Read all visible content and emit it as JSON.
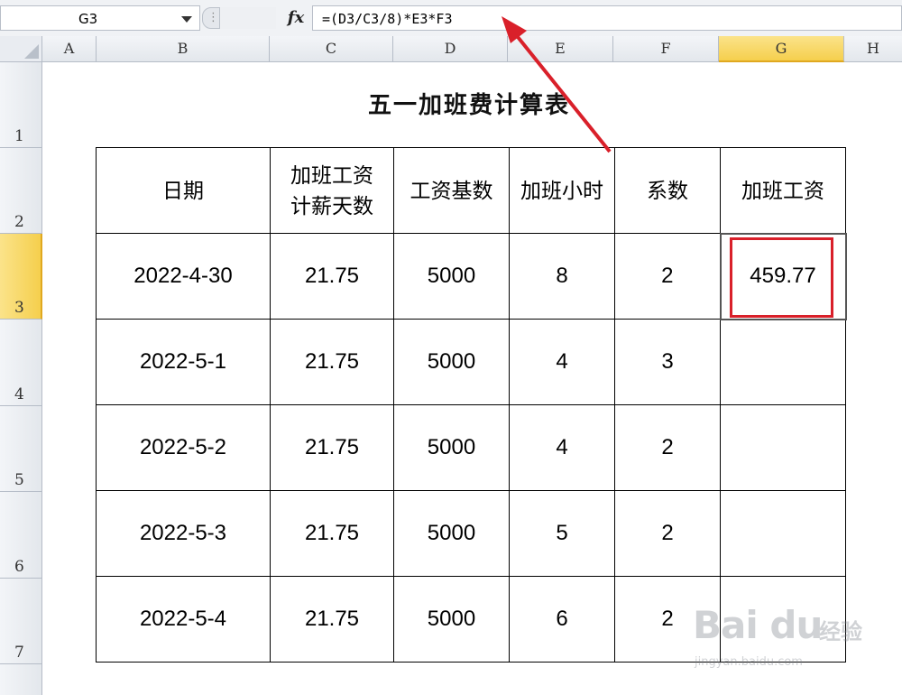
{
  "formula_bar": {
    "cell_ref": "G3",
    "fx_label": "fx",
    "formula": "=(D3/C3/8)*E3*F3"
  },
  "columns": [
    "A",
    "B",
    "C",
    "D",
    "E",
    "F",
    "G",
    "H"
  ],
  "selected_column": "G",
  "rows": [
    "1",
    "2",
    "3",
    "4",
    "5",
    "6",
    "7"
  ],
  "selected_row": "3",
  "sheet": {
    "title": "五一加班费计算表",
    "headers": [
      "日期",
      "加班工资计薪天数",
      "工资基数",
      "加班小时",
      "系数",
      "加班工资"
    ],
    "header_lines": {
      "col_c": [
        "加班工资",
        "计薪天数"
      ]
    },
    "data_rows": [
      {
        "date": "2022-4-30",
        "days": "21.75",
        "base": "5000",
        "hours": "8",
        "coef": "2",
        "pay": "459.77"
      },
      {
        "date": "2022-5-1",
        "days": "21.75",
        "base": "5000",
        "hours": "4",
        "coef": "3",
        "pay": ""
      },
      {
        "date": "2022-5-2",
        "days": "21.75",
        "base": "5000",
        "hours": "4",
        "coef": "2",
        "pay": ""
      },
      {
        "date": "2022-5-3",
        "days": "21.75",
        "base": "5000",
        "hours": "5",
        "coef": "2",
        "pay": ""
      },
      {
        "date": "2022-5-4",
        "days": "21.75",
        "base": "5000",
        "hours": "6",
        "coef": "2",
        "pay": ""
      }
    ]
  },
  "colors": {
    "selected_header": "#f5cf4d",
    "highlight_box": "#d9202a",
    "arrow": "#d9202a"
  },
  "watermark": {
    "brand": "Bai du",
    "cn": "经验",
    "url": "jingyan.baidu.com"
  }
}
